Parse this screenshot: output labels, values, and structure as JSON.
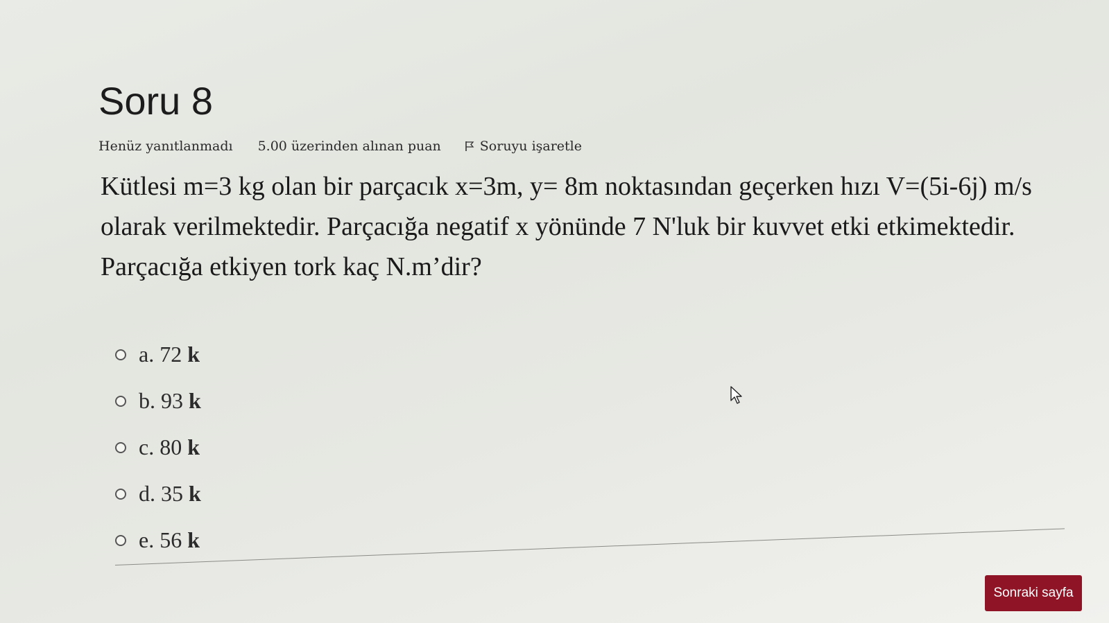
{
  "question": {
    "title": "Soru 8",
    "status": "Henüz yanıtlanmadı",
    "grade": "5.00 üzerinden alınan puan",
    "flag_label": "Soruyu işaretle",
    "text_lines": [
      "Kütlesi m=3 kg olan bir parçacık x=3m, y= 8m noktasından geçerken hızı V=(5i-6j) m/s",
      "olarak verilmektedir. Parçacığa negatif x yönünde 7 N'luk bir kuvvet etki etkimektedir.",
      "Parçacığa etkiyen tork kaç N.m’dir?"
    ],
    "options": [
      {
        "letter": "a.",
        "value": "72",
        "unit": "k"
      },
      {
        "letter": "b.",
        "value": "93",
        "unit": "k"
      },
      {
        "letter": "c.",
        "value": "80",
        "unit": "k"
      },
      {
        "letter": "d.",
        "value": "35",
        "unit": "k"
      },
      {
        "letter": "e.",
        "value": "56",
        "unit": "k"
      }
    ]
  },
  "navigation": {
    "next_label": "Sonraki sayfa"
  },
  "colors": {
    "next_button": "#8e1426"
  },
  "icons": {
    "flag": "flag-icon",
    "cursor": "mouse-pointer-icon"
  }
}
